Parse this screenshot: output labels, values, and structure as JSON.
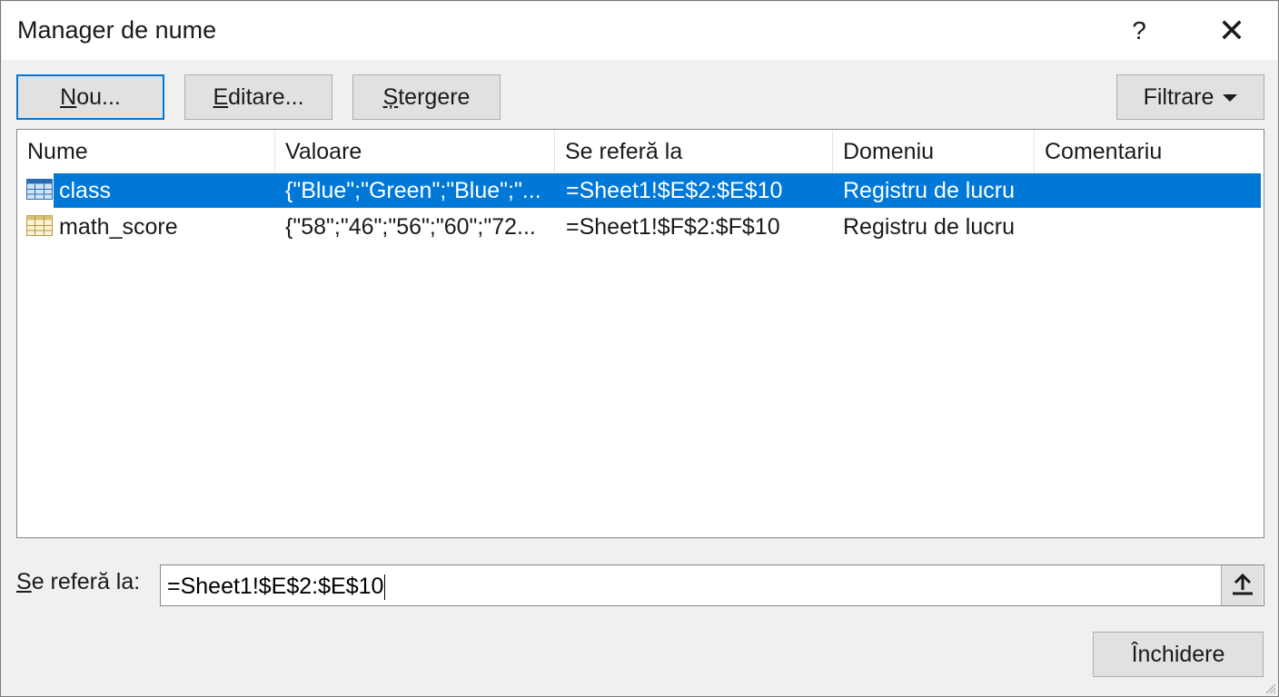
{
  "window": {
    "title": "Manager de nume",
    "help_label": "?",
    "close_label": "✕"
  },
  "toolbar": {
    "new_label": [
      "N",
      "ou..."
    ],
    "edit_label": [
      "E",
      "ditare..."
    ],
    "delete_label": [
      "Ș",
      "tergere"
    ],
    "filter_label": "Filtrare"
  },
  "table": {
    "columns": [
      "Nume",
      "Valoare",
      "Se referă la",
      "Domeniu",
      "Comentariu"
    ],
    "rows": [
      {
        "name": "class",
        "value": "{\"Blue\";\"Green\";\"Blue\";\"...",
        "refers_to": "=Sheet1!$E$2:$E$10",
        "scope": "Registru de lucru",
        "comment": "",
        "selected": true
      },
      {
        "name": "math_score",
        "value": "{\"58\";\"46\";\"56\";\"60\";\"72...",
        "refers_to": "=Sheet1!$F$2:$F$10",
        "scope": "Registru de lucru",
        "comment": "",
        "selected": false
      }
    ]
  },
  "refers_to_field": {
    "label": [
      "S",
      "e referă la:"
    ],
    "value": "=Sheet1!$E$2:$E$10"
  },
  "footer": {
    "close_label": "Închidere"
  },
  "colors": {
    "selection": "#0078d7",
    "focus_border": "#0078d7",
    "dialog_bg": "#f0f0f0"
  }
}
